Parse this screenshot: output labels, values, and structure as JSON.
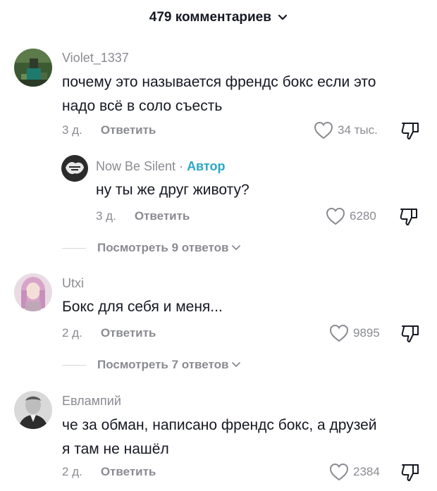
{
  "header": {
    "comment_count": "479 комментариев"
  },
  "comments": [
    {
      "username": "Violet_1337",
      "text_line1": "почему это называется френдс бокс если это",
      "text_line2": "надо всё в соло съесть",
      "time": "3 д.",
      "reply_label": "Ответить",
      "likes": "34 тыс."
    },
    {
      "username": "Now Be Silent",
      "separator": " · ",
      "author_tag": "Автор",
      "text_line1": "ну ты же друг животу?",
      "time": "3 д.",
      "reply_label": "Ответить",
      "likes": "6280"
    },
    {
      "username": "Utxi",
      "text_line1": "Бокс для себя и меня...",
      "time": "2 д.",
      "reply_label": "Ответить",
      "likes": "9895"
    },
    {
      "username": "Евлампий",
      "text_line1": "че за обман, написано френдс бокс, а друзей",
      "text_line2": "я там не нашёл",
      "time": "2 д.",
      "reply_label": "Ответить",
      "likes": "2384"
    }
  ],
  "view_more": [
    {
      "label": "Посмотреть 9 ответов"
    },
    {
      "label": "Посмотреть 7 ответов"
    }
  ]
}
